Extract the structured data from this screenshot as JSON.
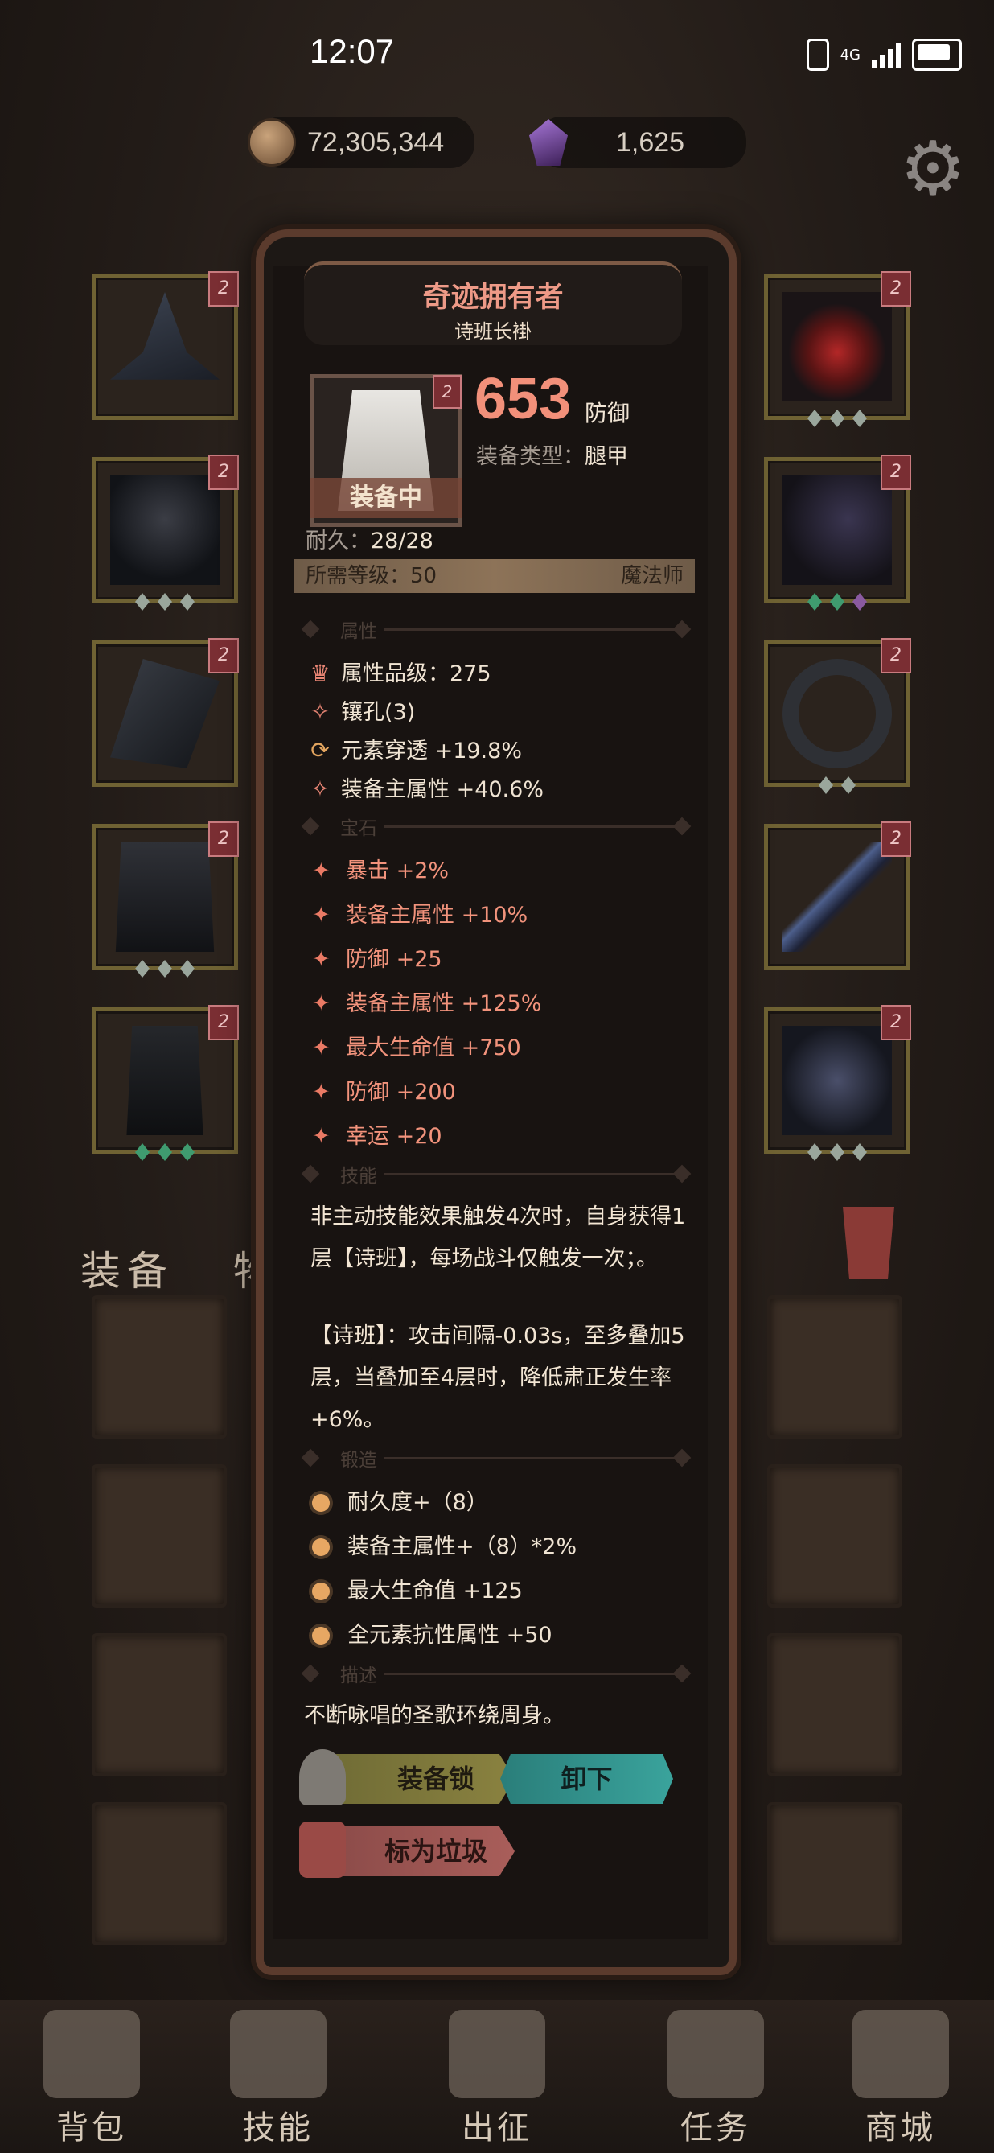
{
  "status_bar": {
    "time": "12:07",
    "network": "4G"
  },
  "currency": {
    "coins": "72,305,344",
    "gems": "1,625"
  },
  "icons": {
    "settings": "gear-icon",
    "coin": "coin-icon",
    "gem": "gem-icon"
  },
  "tabs": {
    "equipment": "装备",
    "items": "物品"
  },
  "tooltip": {
    "title": "奇迹拥有者",
    "subtitle": "诗班长褂",
    "tier_badge": "2",
    "equipped_label": "装备中",
    "defense_value": "653",
    "defense_label": "防御",
    "type_label": "装备类型：",
    "type_value": "腿甲",
    "durability_label": "耐久：",
    "durability_value": "28/28",
    "required_level": "所需等级：50",
    "class": "魔法师",
    "sections": {
      "attributes": "属性",
      "gems": "宝石",
      "skills": "技能",
      "forging": "锻造",
      "description": "描述"
    },
    "attributes": [
      "属性品级：275",
      "镶孔(3)",
      "元素穿透 +19.8%",
      "装备主属性 +40.6%"
    ],
    "gem_stats": [
      "暴击 +2%",
      "装备主属性 +10%",
      "防御 +25",
      "装备主属性 +125%",
      "最大生命值 +750",
      "防御 +200",
      "幸运 +20"
    ],
    "skill_line1": "非主动技能效果触发4次时，自身获得1层【诗班】，每场战斗仅触发一次；。",
    "skill_line2": "【诗班】：攻击间隔-0.03s，至多叠加5层，当叠加至4层时，降低肃正发生率+6%。",
    "forging": [
      "耐久度+（8）",
      "装备主属性+（8）*2%",
      "最大生命值 +125",
      "全元素抗性属性 +50"
    ],
    "description": "不断咏唱的圣歌环绕周身。",
    "buttons": {
      "lock": "装备锁",
      "unequip": "卸下",
      "trash": "标为垃圾"
    }
  },
  "nav": [
    "背包",
    "技能",
    "出征",
    "任务",
    "商城"
  ],
  "colors": {
    "accent": "#f2907a",
    "panel": "#181412",
    "teal": "#3aa39c"
  }
}
